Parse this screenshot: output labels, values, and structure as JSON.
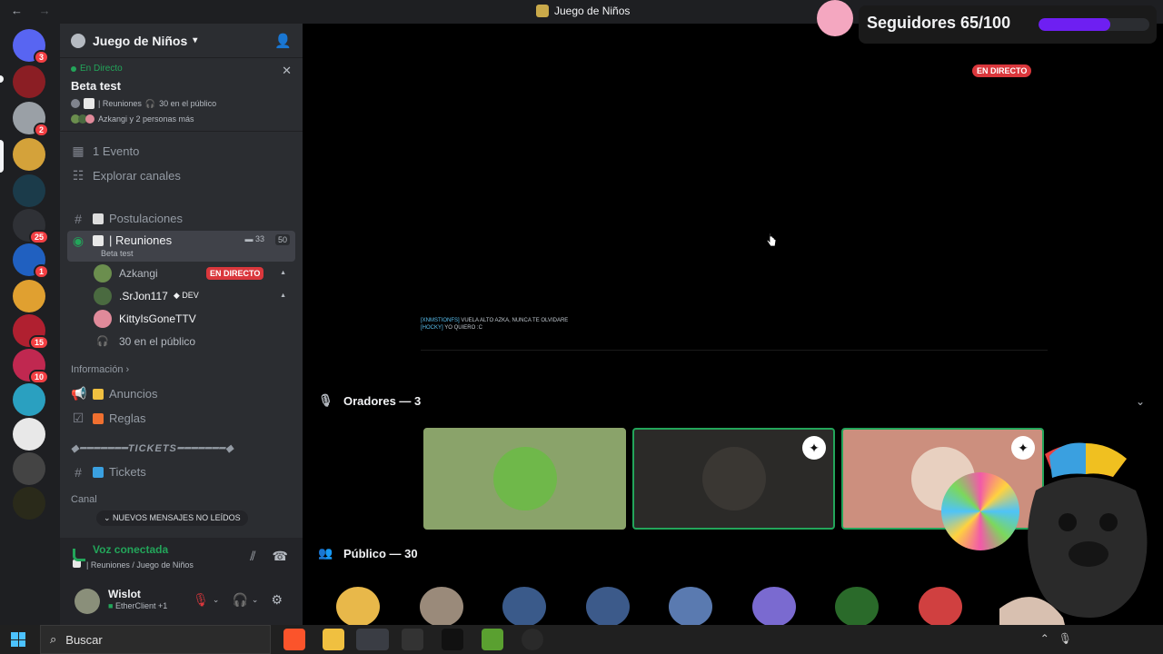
{
  "window": {
    "title": "Juego de Niños",
    "back": "←",
    "forward": "→"
  },
  "servers": [
    {
      "name": "discord-home",
      "badge": "3",
      "color": "#5865f2"
    },
    {
      "name": "betatest",
      "badge": "",
      "color": "#8b1e24"
    },
    {
      "name": "chess-server",
      "badge": "2",
      "color": "#9aa0a6"
    },
    {
      "name": "juego-de-ninos",
      "badge": "",
      "color": "#d4a23a"
    },
    {
      "name": "mountain-server",
      "badge": "",
      "color": "#1b3b4a"
    },
    {
      "name": "logo-server",
      "badge": "25",
      "color": "#2f3136"
    },
    {
      "name": "sonic-server",
      "badge": "1",
      "color": "#2060c0"
    },
    {
      "name": "pug-server",
      "badge": "",
      "color": "#e0a030"
    },
    {
      "name": "speaker-server",
      "badge": "15",
      "color": "#b02030"
    },
    {
      "name": "anime-server",
      "badge": "10",
      "color": "#c02850"
    },
    {
      "name": "bird-server",
      "badge": "",
      "color": "#2aa0c0"
    },
    {
      "name": "el-grupo-server",
      "badge": "",
      "color": "#e8e8e8"
    },
    {
      "name": "mask-server",
      "badge": "",
      "color": "#444"
    },
    {
      "name": "gold-server",
      "badge": "",
      "color": "#2a2a1a"
    }
  ],
  "guild": {
    "name": "Juego de Niños"
  },
  "live_event": {
    "status": "En Directo",
    "name": "Beta test",
    "channel": "| Reuniones",
    "audience": "30 en el público",
    "participants": "Azkangi y 2 personas más"
  },
  "nav": {
    "events": "1 Evento",
    "browse": "Explorar canales"
  },
  "channels": {
    "postulaciones": "Postulaciones",
    "reuniones": "| Reuniones",
    "reuniones_sub": "Beta test",
    "reuniones_count": "33",
    "reuniones_limit": "50"
  },
  "stage_members": [
    {
      "name": "Azkangi",
      "tag": "EN DIRECTO",
      "color": "#6b8e4e"
    },
    {
      "name": ".SrJon117",
      "tag": "DEV",
      "color": "#4a6a40"
    },
    {
      "name": "KittyIsGoneTTV",
      "tag": "",
      "color": "#e08a9a"
    }
  ],
  "stage_audience": "30 en el público",
  "categories": {
    "info": "Información",
    "anuncios": "Anuncios",
    "reglas": "Reglas",
    "tickets_cat": "◆━━━━━━━TICKETS━━━━━━━◆",
    "tickets": "Tickets",
    "canales": "Canal",
    "unread": "NUEVOS MENSAJES NO LEÍDOS"
  },
  "voice": {
    "status": "Voz conectada",
    "location": "| Reuniones / Juego de Niños"
  },
  "user": {
    "name": "Wislot",
    "client": "EtherClient +1"
  },
  "followers": {
    "label": "Seguidores 65/100",
    "progress": 0.65
  },
  "stream": {
    "live_badge": "EN DIRECTO",
    "chat_line1_user": "[XNMSTIONFS]",
    "chat_line1_text": "VUELA ALTO AZKA, NUNCA TE OLVIDARE",
    "chat_line2_user": "[HOCKY]",
    "chat_line2_text": "YO QUIERO :C"
  },
  "speakers": {
    "title": "Oradores — 3",
    "tiles": [
      {
        "bg": "#8aa36a",
        "avatar": "#6fb84a",
        "mod": false
      },
      {
        "bg": "#2b2a28",
        "avatar": "#3a3733",
        "mod": true
      },
      {
        "bg": "#cc8f7e",
        "avatar": "#e8d0c0",
        "mod": true
      }
    ]
  },
  "audience": {
    "title": "Público — 30",
    "avatars": [
      "#e8b84a",
      "#9a8a7a",
      "#3a5a8a",
      "#3c5a8a",
      "#5a7ab0",
      "#7a6ad0",
      "#2a6a2a",
      "#d04040"
    ]
  },
  "taskbar": {
    "search_placeholder": "Buscar"
  }
}
